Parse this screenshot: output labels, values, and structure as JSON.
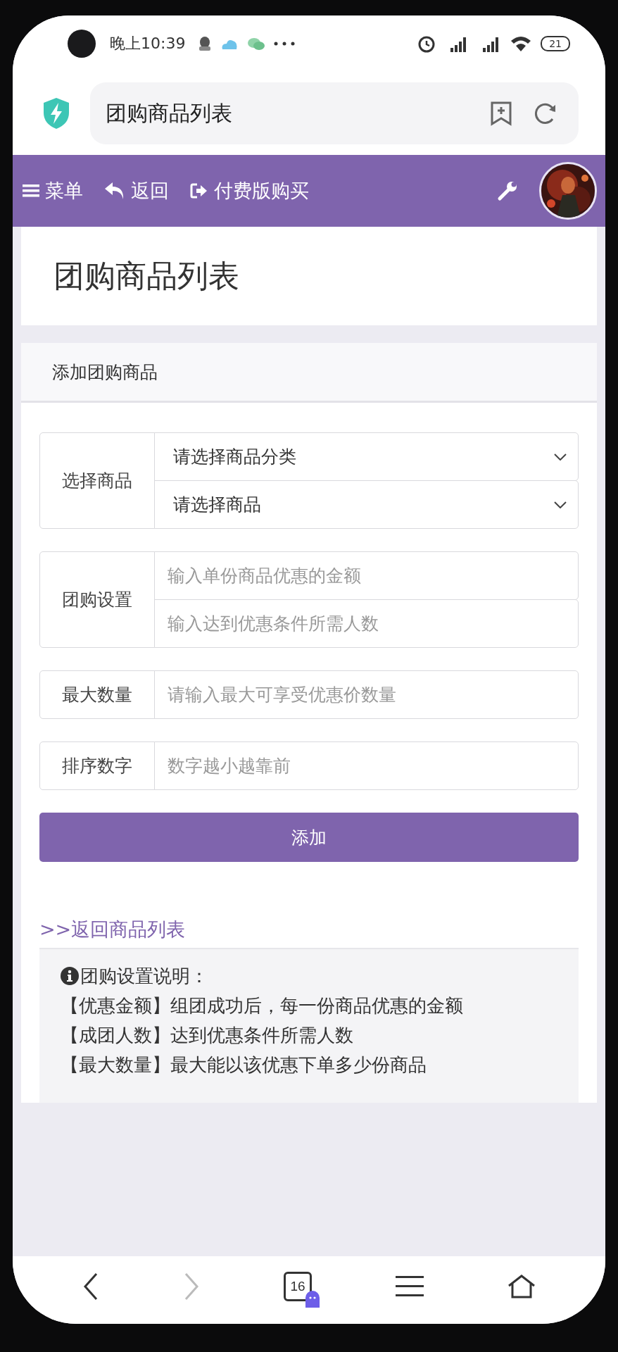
{
  "status_bar": {
    "time": "晚上10:39",
    "battery": "21"
  },
  "browser": {
    "address": "团购商品列表"
  },
  "nav": {
    "items": [
      {
        "kind": "menu",
        "label": "菜单"
      },
      {
        "kind": "back",
        "label": "返回"
      },
      {
        "kind": "buy",
        "label": "付费版购买"
      }
    ]
  },
  "page_title": "团购商品列表",
  "card": {
    "title": "添加团购商品",
    "groups": [
      {
        "label": "选择商品",
        "fields": [
          {
            "kind": "select",
            "value": "请选择商品分类"
          },
          {
            "kind": "select",
            "value": "请选择商品"
          }
        ]
      },
      {
        "label": "团购设置",
        "fields": [
          {
            "kind": "input",
            "placeholder": "输入单份商品优惠的金额"
          },
          {
            "kind": "input",
            "placeholder": "输入达到优惠条件所需人数"
          }
        ]
      },
      {
        "label": "最大数量",
        "fields": [
          {
            "kind": "input",
            "placeholder": "请输入最大可享受优惠价数量"
          }
        ]
      },
      {
        "label": "排序数字",
        "fields": [
          {
            "kind": "input",
            "placeholder": "数字越小越靠前"
          }
        ]
      }
    ],
    "submit": "添加"
  },
  "back_link": ">>返回商品列表",
  "notes": {
    "title": "团购设置说明：",
    "lines": [
      "【优惠金额】组团成功后，每一份商品优惠的金额",
      "【成团人数】达到优惠条件所需人数",
      "【最大数量】最大能以该优惠下单多少份商品"
    ]
  },
  "bottom_bar": {
    "tab_count": "16",
    "buttons": [
      {
        "kind": "back",
        "disabled": false
      },
      {
        "kind": "forward",
        "disabled": true
      },
      {
        "kind": "tabs",
        "disabled": false
      },
      {
        "kind": "menu",
        "disabled": false
      },
      {
        "kind": "home",
        "disabled": false
      }
    ]
  }
}
